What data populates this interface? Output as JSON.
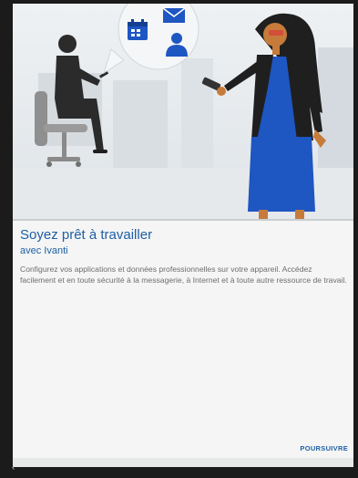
{
  "onboarding": {
    "title": "Soyez prêt à travailler",
    "subtitle": "avec Ivanti",
    "description": "Configurez vos applications et données professionnelles sur votre appareil. Accédez facilement et en toute sécurité à la messagerie, à Internet et à toute autre ressource de travail."
  },
  "actions": {
    "continue_label": "POURSUIVRE"
  },
  "icons": {
    "illustration_bubble": [
      "calendar-icon",
      "mail-icon",
      "person-icon"
    ],
    "nav_back": "back-icon"
  },
  "colors": {
    "accent": "#1f5fa4",
    "illustration_blue": "#1e56c2",
    "illustration_dark": "#2b2b2b",
    "skin": "#c77b3a"
  }
}
